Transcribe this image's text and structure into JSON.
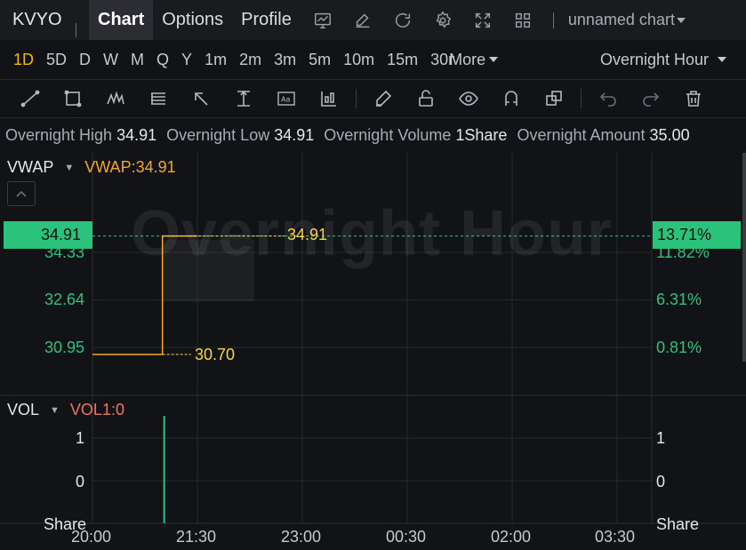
{
  "header": {
    "ticker": "KVYO",
    "tabs": [
      "Chart",
      "Options",
      "Profile"
    ],
    "chart_name": "unnamed chart"
  },
  "intervals": {
    "items": [
      "1D",
      "5D",
      "D",
      "W",
      "M",
      "Q",
      "Y",
      "1m",
      "2m",
      "3m",
      "5m",
      "10m",
      "15m",
      "30m"
    ],
    "more_label": "More",
    "session_label": "Overnight Hour"
  },
  "info": {
    "high_label": "Overnight High",
    "high_value": "34.91",
    "low_label": "Overnight Low",
    "low_value": "34.91",
    "volume_label": "Overnight Volume",
    "volume_value": "1Share",
    "amount_label": "Overnight Amount",
    "amount_value": "35.00"
  },
  "indicators": {
    "main_name": "VWAP",
    "main_value": "VWAP:34.91",
    "vol_name": "VOL",
    "vol_value": "VOL1:0"
  },
  "watermark": "Overnight Hour",
  "colors": {
    "accent": "#f5b800",
    "up": "#2bc27c",
    "vwap": "#f5a623",
    "vol": "#f07468",
    "label": "#f5d547"
  },
  "chart_data": {
    "type": "line",
    "x_ticks": [
      "20:00",
      "21:30",
      "23:00",
      "00:30",
      "02:00",
      "03:30"
    ],
    "price_axis": {
      "ticks": [
        "34.33",
        "32.64",
        "30.95"
      ],
      "current": "34.91"
    },
    "percent_axis": {
      "ticks": [
        "11.82%",
        "6.31%",
        "0.81%"
      ],
      "current": "13.71%"
    },
    "line_labels": {
      "high": "34.91",
      "low": "30.70"
    },
    "vwap_series": [
      {
        "x": "20:00",
        "y": 30.7
      },
      {
        "x": "21:00",
        "y": 30.7
      },
      {
        "x": "21:00",
        "y": 34.91
      },
      {
        "x": "21:30",
        "y": 34.91
      }
    ],
    "volume_axis": {
      "ticks": [
        "1",
        "0"
      ],
      "unit": "Share"
    },
    "volume_bars": [
      {
        "x": "21:00",
        "value": 1
      }
    ]
  }
}
